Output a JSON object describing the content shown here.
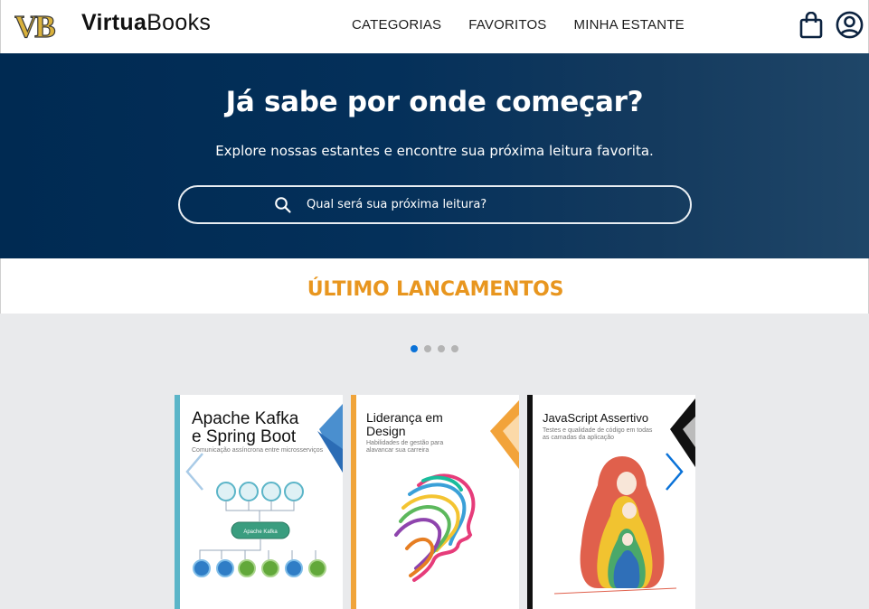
{
  "brand": {
    "logo_mark": "VB",
    "name_bold": "Virtua",
    "name_light": "Books"
  },
  "nav": {
    "items": [
      "CATEGORIAS",
      "FAVORITOS",
      "MINHA ESTANTE"
    ]
  },
  "header_icons": [
    "shopping-bag-icon",
    "user-account-icon"
  ],
  "hero": {
    "title": "Já sabe por onde começar?",
    "subtitle": "Explore nossas estantes e encontre sua próxima leitura favorita.",
    "search_placeholder": "Qual será sua próxima leitura?"
  },
  "section": {
    "title": "ÚLTIMO LANCAMENTOS"
  },
  "carousel": {
    "dots": 4,
    "active_dot": 0,
    "books": [
      {
        "title_line1": "Apache Kafka",
        "title_line2": "e Spring Boot",
        "subtitle": "Comunicação assíncrona entre microsserviços",
        "diagram_center": "Apache Kafka",
        "accent": "#5bb5c8"
      },
      {
        "title_line1": "Liderança em",
        "title_line2": "Design",
        "subtitle": "Habilidades de gestão para alavancar sua carreira",
        "accent": "#f0a43a"
      },
      {
        "title_line1": "JavaScript Assertivo",
        "title_line2": "",
        "subtitle": "Testes e qualidade de código em todas as camadas da aplicação",
        "accent": "#111111"
      }
    ]
  },
  "colors": {
    "hero_bg": "#002a52",
    "section_title": "#e8961f",
    "carousel_bg": "#e9eaec",
    "active_dot": "#0a72d8"
  }
}
